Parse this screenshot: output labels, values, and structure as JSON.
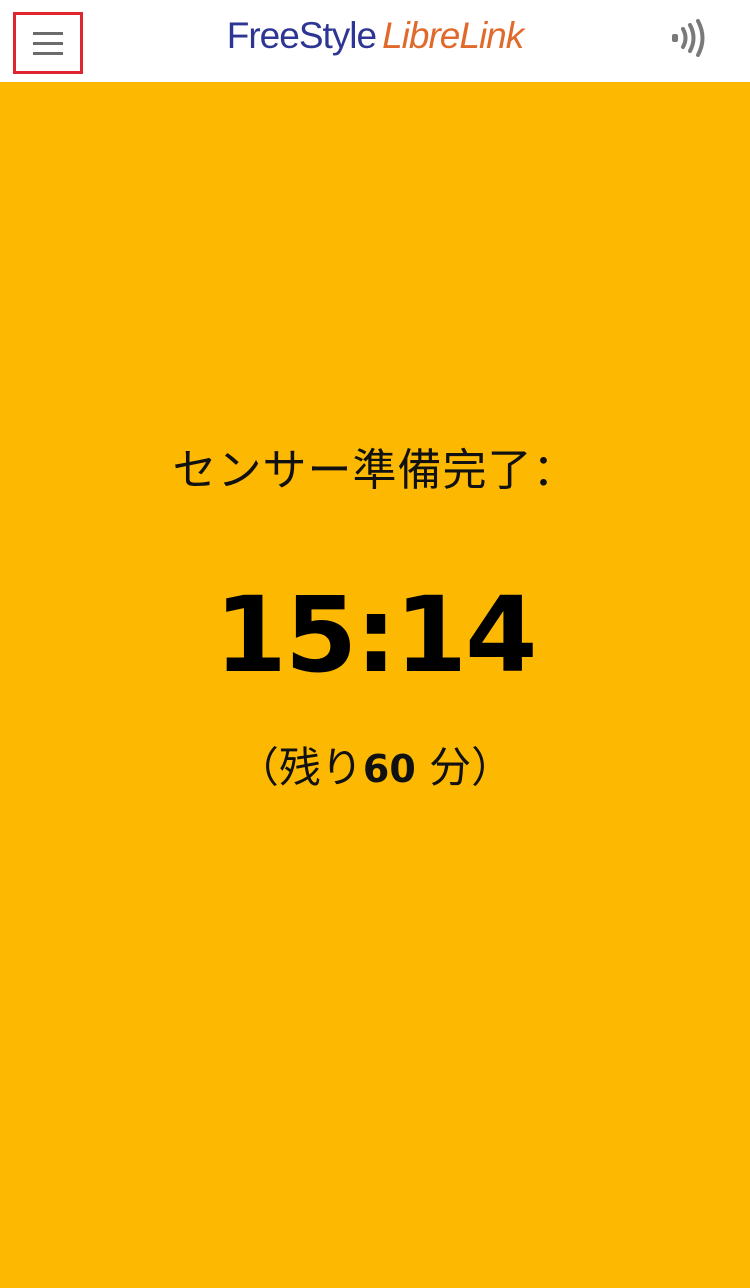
{
  "header": {
    "logo_freestyle": "FreeStyle",
    "logo_librelink": "LibreLink",
    "logo_colors": {
      "freestyle": "#2d3694",
      "librelink": "#e06a2c"
    },
    "menu_icon": "hamburger-menu-icon",
    "nfc_icon": "nfc-scan-icon",
    "menu_highlight_color": "#e02531"
  },
  "main": {
    "background_color": "#fdb902",
    "status_label": "センサー準備完了：",
    "ready_time": "15:14",
    "remaining_prefix": "（残り",
    "remaining_minutes": "60",
    "remaining_suffix": " 分）"
  }
}
